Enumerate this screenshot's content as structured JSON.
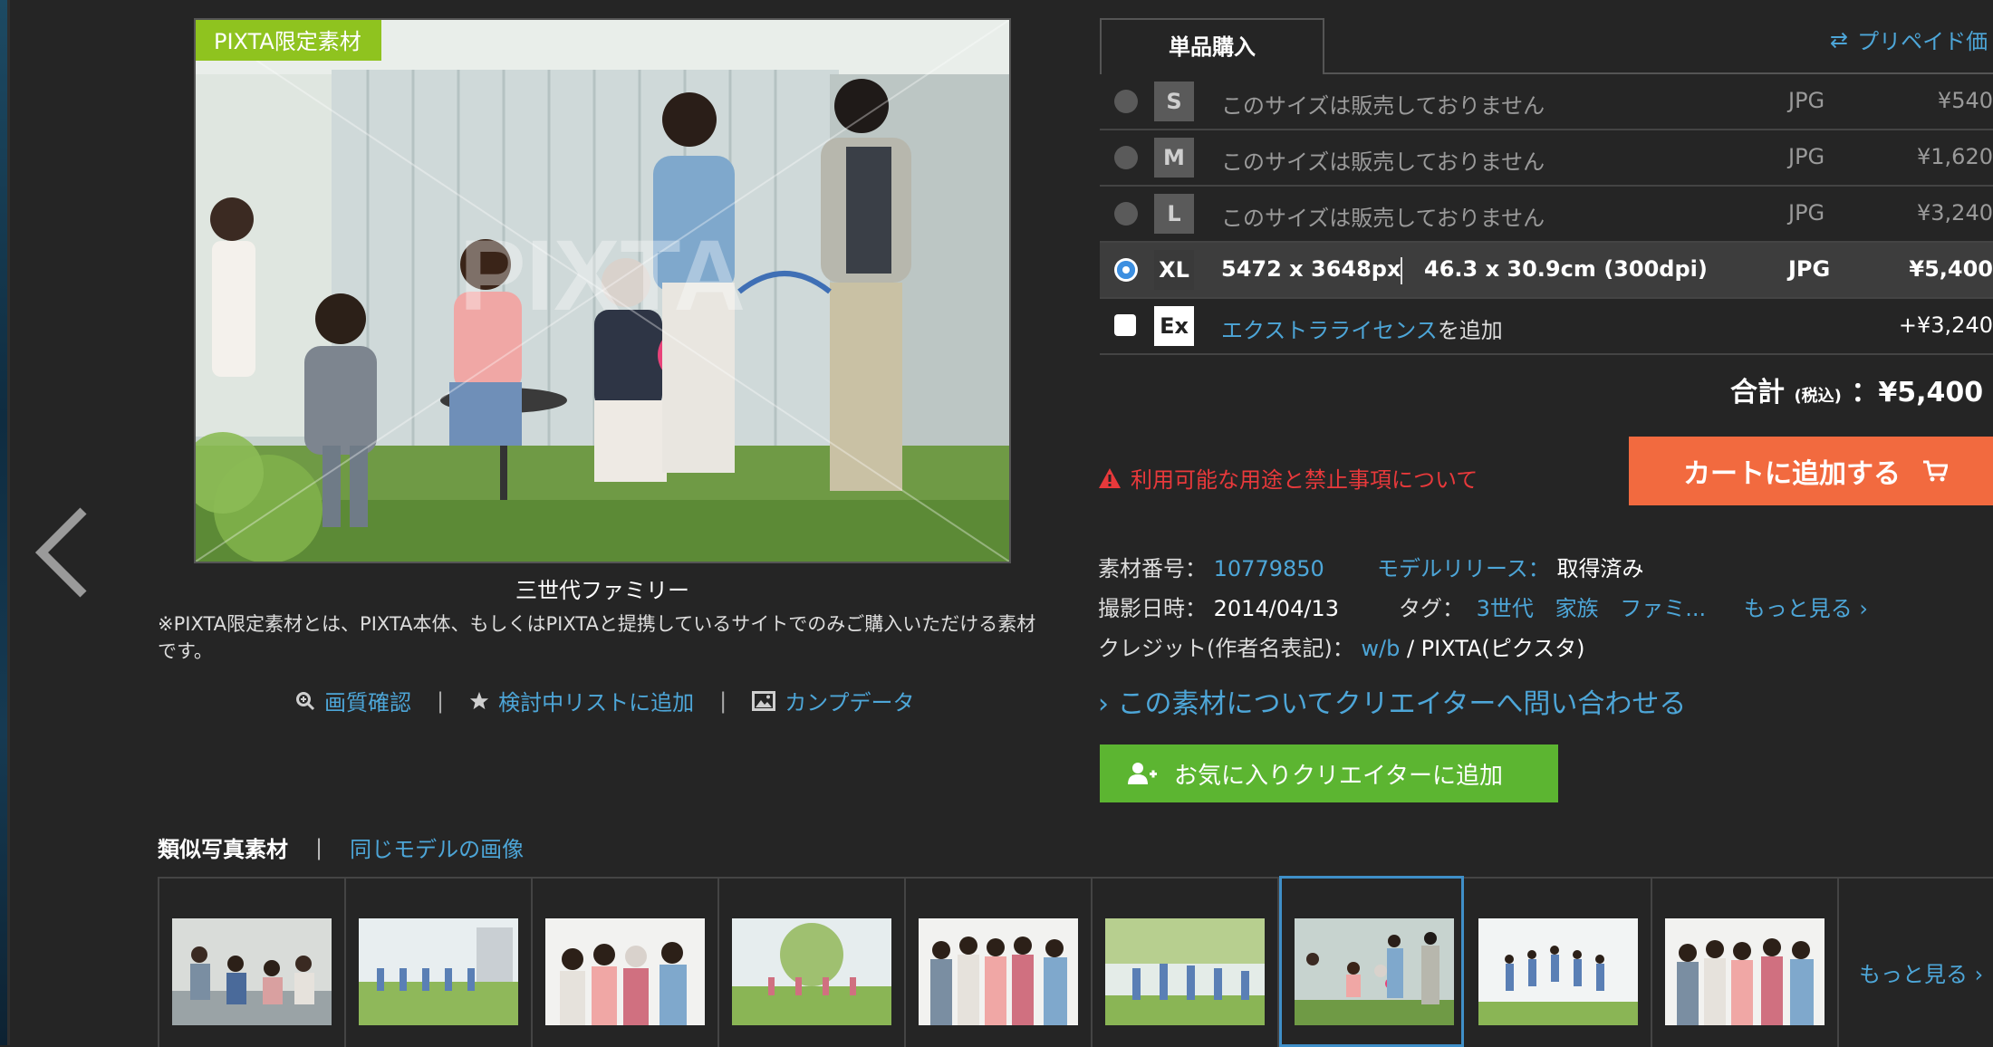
{
  "image": {
    "badge": "PIXTA限定素材",
    "watermark": "PIXTA",
    "title": "三世代ファミリー",
    "note": "※PIXTA限定素材とは、PIXTA本体、もしくはPIXTAと提携しているサイトでのみご購入いただける素材です。"
  },
  "tools": {
    "quality": "画質確認",
    "wishlist": "検討中リストに追加",
    "comp": "カンプデータ"
  },
  "purchase": {
    "tab": "単品購入",
    "prepaid": "プリペイド価",
    "sizes": [
      {
        "size": "S",
        "desc": "このサイズは販売しておりません",
        "format": "JPG",
        "price": "¥540"
      },
      {
        "size": "M",
        "desc": "このサイズは販売しておりません",
        "format": "JPG",
        "price": "¥1,620"
      },
      {
        "size": "L",
        "desc": "このサイズは販売しておりません",
        "format": "JPG",
        "price": "¥3,240"
      },
      {
        "size": "XL",
        "px": "5472 x 3648px",
        "cm": "46.3 x 30.9cm (300dpi)",
        "format": "JPG",
        "price": "¥5,400"
      }
    ],
    "extra": {
      "size": "Ex",
      "link": "エクストラライセンス",
      "suffix": "を追加",
      "price": "+¥3,240"
    },
    "total_label": "合計",
    "total_tax": "(税込)",
    "total_value": "：¥5,400",
    "warning": "利用可能な用途と禁止事項について",
    "cart_button": "カートに追加する"
  },
  "meta": {
    "id_label": "素材番号：",
    "id_value": "10779850",
    "model_label": "モデルリリース：",
    "model_value": "取得済み",
    "date_label": "撮影日時：",
    "date_value": "2014/04/13",
    "tags_label": "タグ：",
    "tags": [
      "3世代",
      "家族",
      "ファミ..."
    ],
    "more_tags": "もっと見る ›",
    "credit_label": "クレジット(作者名表記)：",
    "credit_user": "w/b",
    "credit_site": " / PIXTA(ピクスタ)"
  },
  "inquiry": "› この素材についてクリエイターへ問い合わせる",
  "fav_button": "お気に入りクリエイターに追加",
  "similar": {
    "tab_active": "類似写真素材",
    "tab_other": "同じモデルの画像",
    "more": "もっと見る ›"
  },
  "colors": {
    "accent": "#4da6d8",
    "cart": "#f26a3f",
    "fav": "#5cb531",
    "badge": "#8fc31f",
    "warning": "#e8393b"
  }
}
